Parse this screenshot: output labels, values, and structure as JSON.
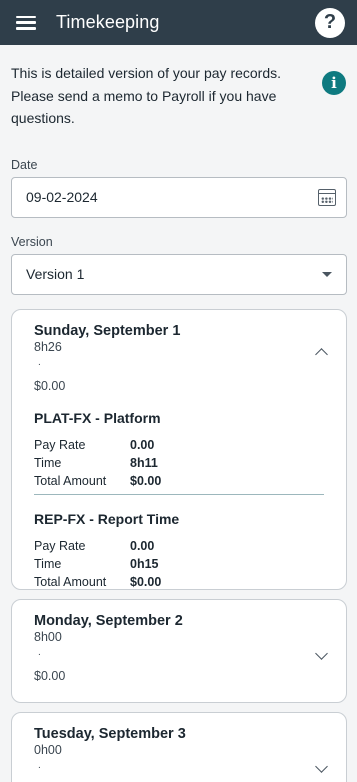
{
  "header": {
    "title": "Timekeeping",
    "help_glyph": "?"
  },
  "intro": {
    "text": "This is detailed version of your pay records. Please send a memo to Payroll if you have questions.",
    "info_glyph": "i"
  },
  "date": {
    "label": "Date",
    "value": "09-02-2024"
  },
  "version": {
    "label": "Version",
    "value": "Version 1"
  },
  "days": [
    {
      "title": "Sunday, September 1",
      "hours": "8h26",
      "dot": ".",
      "amount": "$0.00",
      "expanded": true,
      "entries": [
        {
          "title": "PLAT-FX - Platform",
          "pay_rate_label": "Pay Rate",
          "pay_rate": "0.00",
          "time_label": "Time",
          "time": "8h11",
          "total_label": "Total Amount",
          "total": "$0.00"
        },
        {
          "title": "REP-FX - Report Time",
          "pay_rate_label": "Pay Rate",
          "pay_rate": "0.00",
          "time_label": "Time",
          "time": "0h15",
          "total_label": "Total Amount",
          "total": "$0.00"
        }
      ]
    },
    {
      "title": "Monday, September 2",
      "hours": "8h00",
      "dot": ".",
      "amount": "$0.00",
      "expanded": false
    },
    {
      "title": "Tuesday, September 3",
      "hours": "0h00",
      "dot": ".",
      "expanded": false
    }
  ],
  "colors": {
    "header_bg": "#2f3e4a",
    "accent": "#0e7a80",
    "page_bg": "#f4f5f6"
  },
  "icons": [
    "menu-icon",
    "help-icon",
    "info-icon",
    "calendar-icon",
    "caret-down-icon",
    "chevron-up-icon",
    "chevron-down-icon"
  ]
}
